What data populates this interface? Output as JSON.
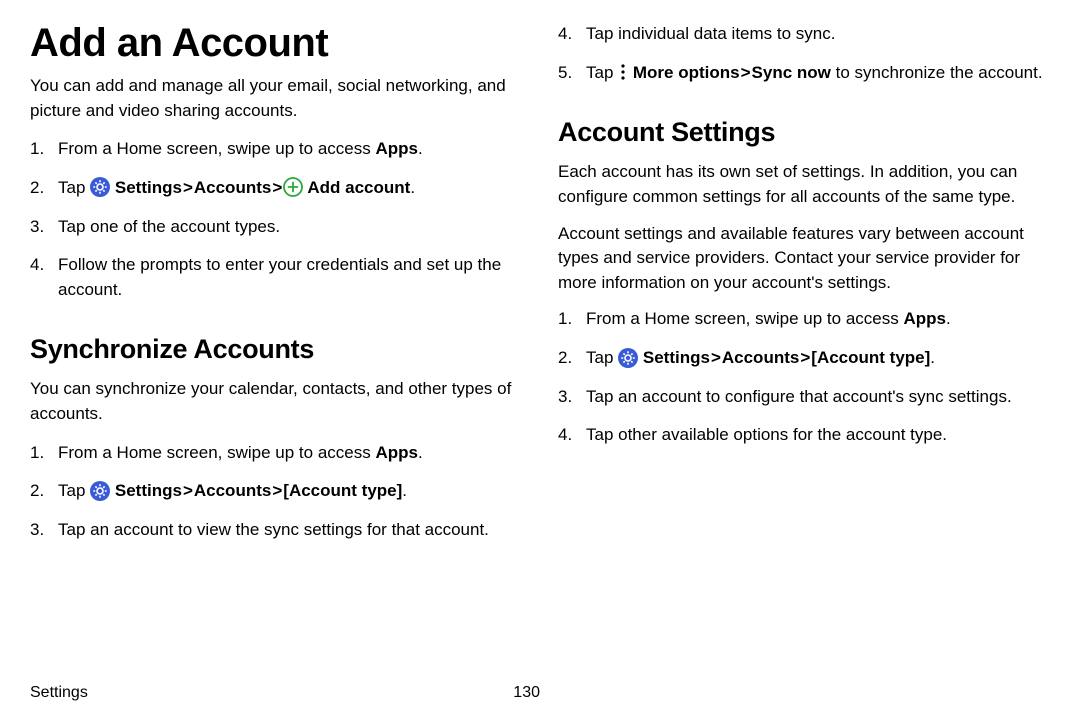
{
  "left": {
    "h1": "Add an Account",
    "intro": "You can add and manage all your email, social networking, and picture and video sharing accounts.",
    "steps": {
      "s1a": "From a Home screen, swipe up to access ",
      "s1b": "Apps",
      "s1c": ".",
      "s2a": "Tap ",
      "s2b": " Settings",
      "s2c": "Accounts",
      "s2d": " Add account",
      "s2e": ".",
      "s3": "Tap one of the account types.",
      "s4": "Follow the prompts to enter your credentials and set up the account."
    },
    "h2": "Synchronize Accounts",
    "intro2": "You can synchronize your calendar, contacts, and other types of accounts.",
    "sync": {
      "s1a": "From a Home screen, swipe up to access ",
      "s1b": "Apps",
      "s1c": ".",
      "s2a": "Tap ",
      "s2b": " Settings",
      "s2c": "Accounts",
      "s2d": "[Account type]",
      "s2e": ".",
      "s3": "Tap an account to view the sync settings for that account."
    }
  },
  "right": {
    "cont": {
      "s4": "Tap individual data items to sync.",
      "s5a": "Tap ",
      "s5b": " More options",
      "s5c": "Sync now",
      "s5d": " to synchronize the account."
    },
    "h2": "Account Settings",
    "p1": "Each account has its own set of settings. In addition, you can configure common settings for all accounts of the same type.",
    "p2": "Account settings and available features vary between account types and service providers. Contact your service provider for more information on your account's settings.",
    "steps": {
      "s1a": "From a Home screen, swipe up to access ",
      "s1b": "Apps",
      "s1c": ".",
      "s2a": "Tap ",
      "s2b": " Settings",
      "s2c": "Accounts",
      "s2d": "[Account type]",
      "s2e": ".",
      "s3": "Tap an account to configure that account's sync settings.",
      "s4": "Tap other available options for the account type."
    }
  },
  "footer": {
    "section": "Settings",
    "page": "130"
  },
  "glyph": {
    "gt": ">"
  }
}
